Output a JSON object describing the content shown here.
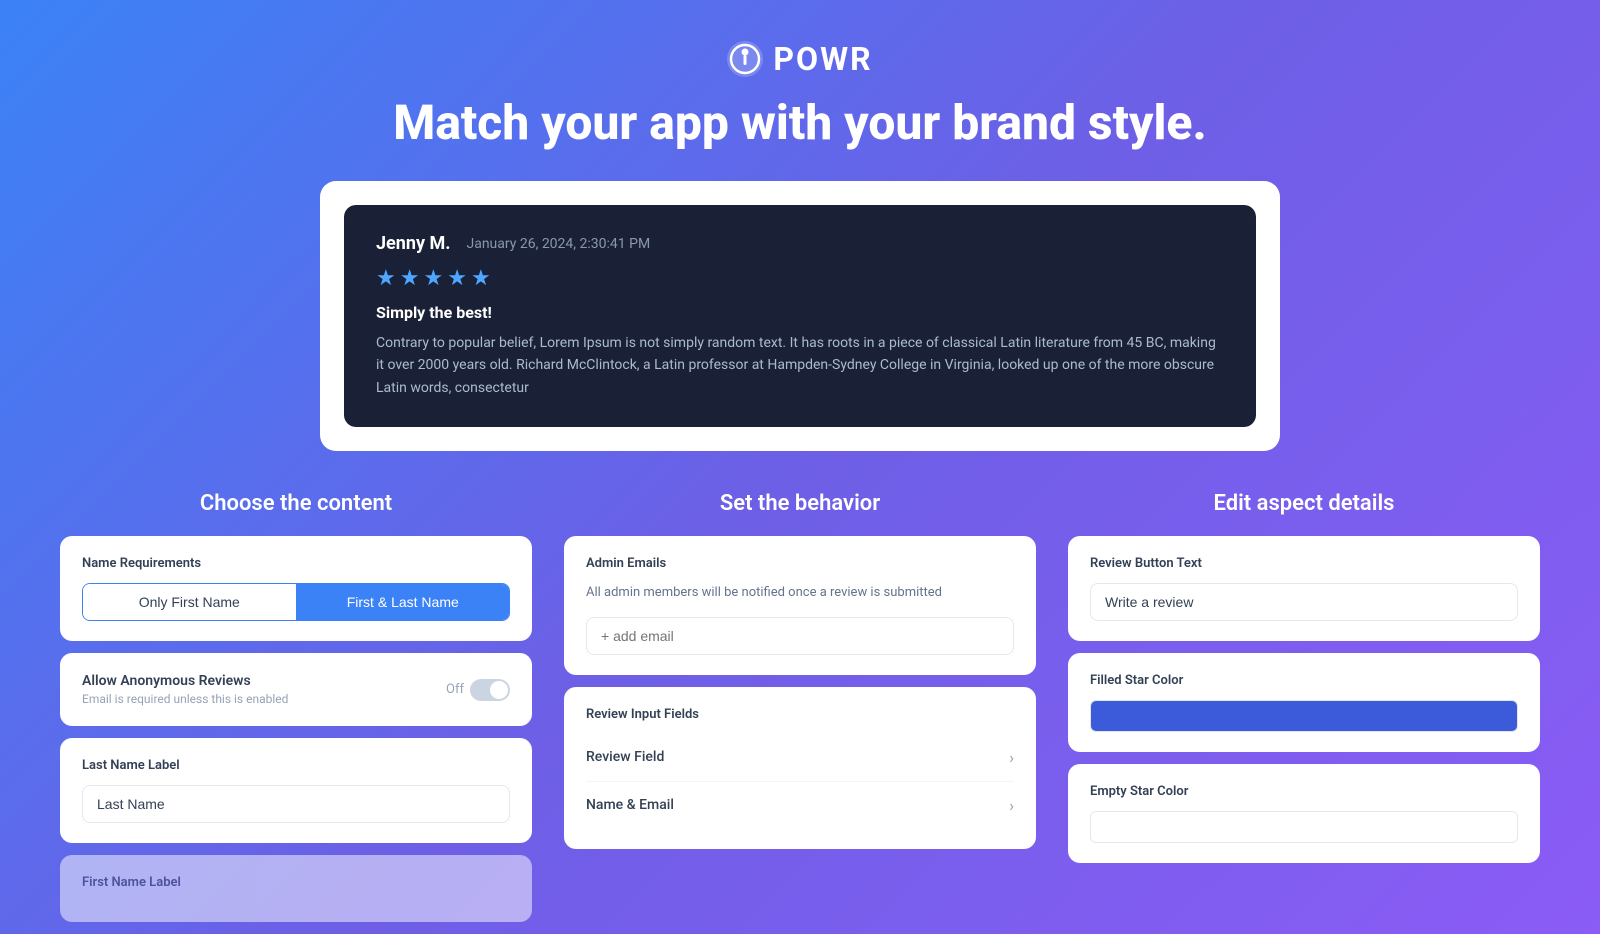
{
  "header": {
    "logo_text": "POWR",
    "tagline": "Match your app with your brand style."
  },
  "review_preview": {
    "reviewer_name": "Jenny M.",
    "review_date": "January 26, 2024, 2:30:41 PM",
    "stars": 5,
    "review_title": "Simply the best!",
    "review_body": "Contrary to popular belief, Lorem Ipsum is not simply random text. It has roots in a piece of classical Latin literature from 45 BC, making it over 2000 years old. Richard McClintock, a Latin professor at Hampden-Sydney College in Virginia, looked up one of the more obscure Latin words, consectetur"
  },
  "content_column": {
    "title": "Choose the content",
    "name_requirements": {
      "label": "Name Requirements",
      "option1": "Only First Name",
      "option2": "First & Last Name",
      "active": "option2"
    },
    "allow_anonymous": {
      "label": "Allow Anonymous Reviews",
      "sublabel": "Email is required unless this is enabled",
      "state": "Off"
    },
    "last_name_label": {
      "label": "Last Name Label",
      "value": "Last Name"
    },
    "first_name_label": {
      "label": "First Name Label"
    }
  },
  "behavior_column": {
    "title": "Set the behavior",
    "admin_emails": {
      "label": "Admin Emails",
      "description": "All admin members will be notified once a review is submitted",
      "placeholder": "+ add email"
    },
    "review_input_fields": {
      "label": "Review Input Fields",
      "fields": [
        {
          "name": "Review Field"
        },
        {
          "name": "Name & Email"
        }
      ]
    }
  },
  "aspect_column": {
    "title": "Edit aspect details",
    "review_button_text": {
      "label": "Review Button Text",
      "value": "Write a review"
    },
    "filled_star_color": {
      "label": "Filled Star Color",
      "color": "#3b5bdb"
    },
    "empty_star_color": {
      "label": "Empty Star Color",
      "color": "#ffffff"
    }
  }
}
